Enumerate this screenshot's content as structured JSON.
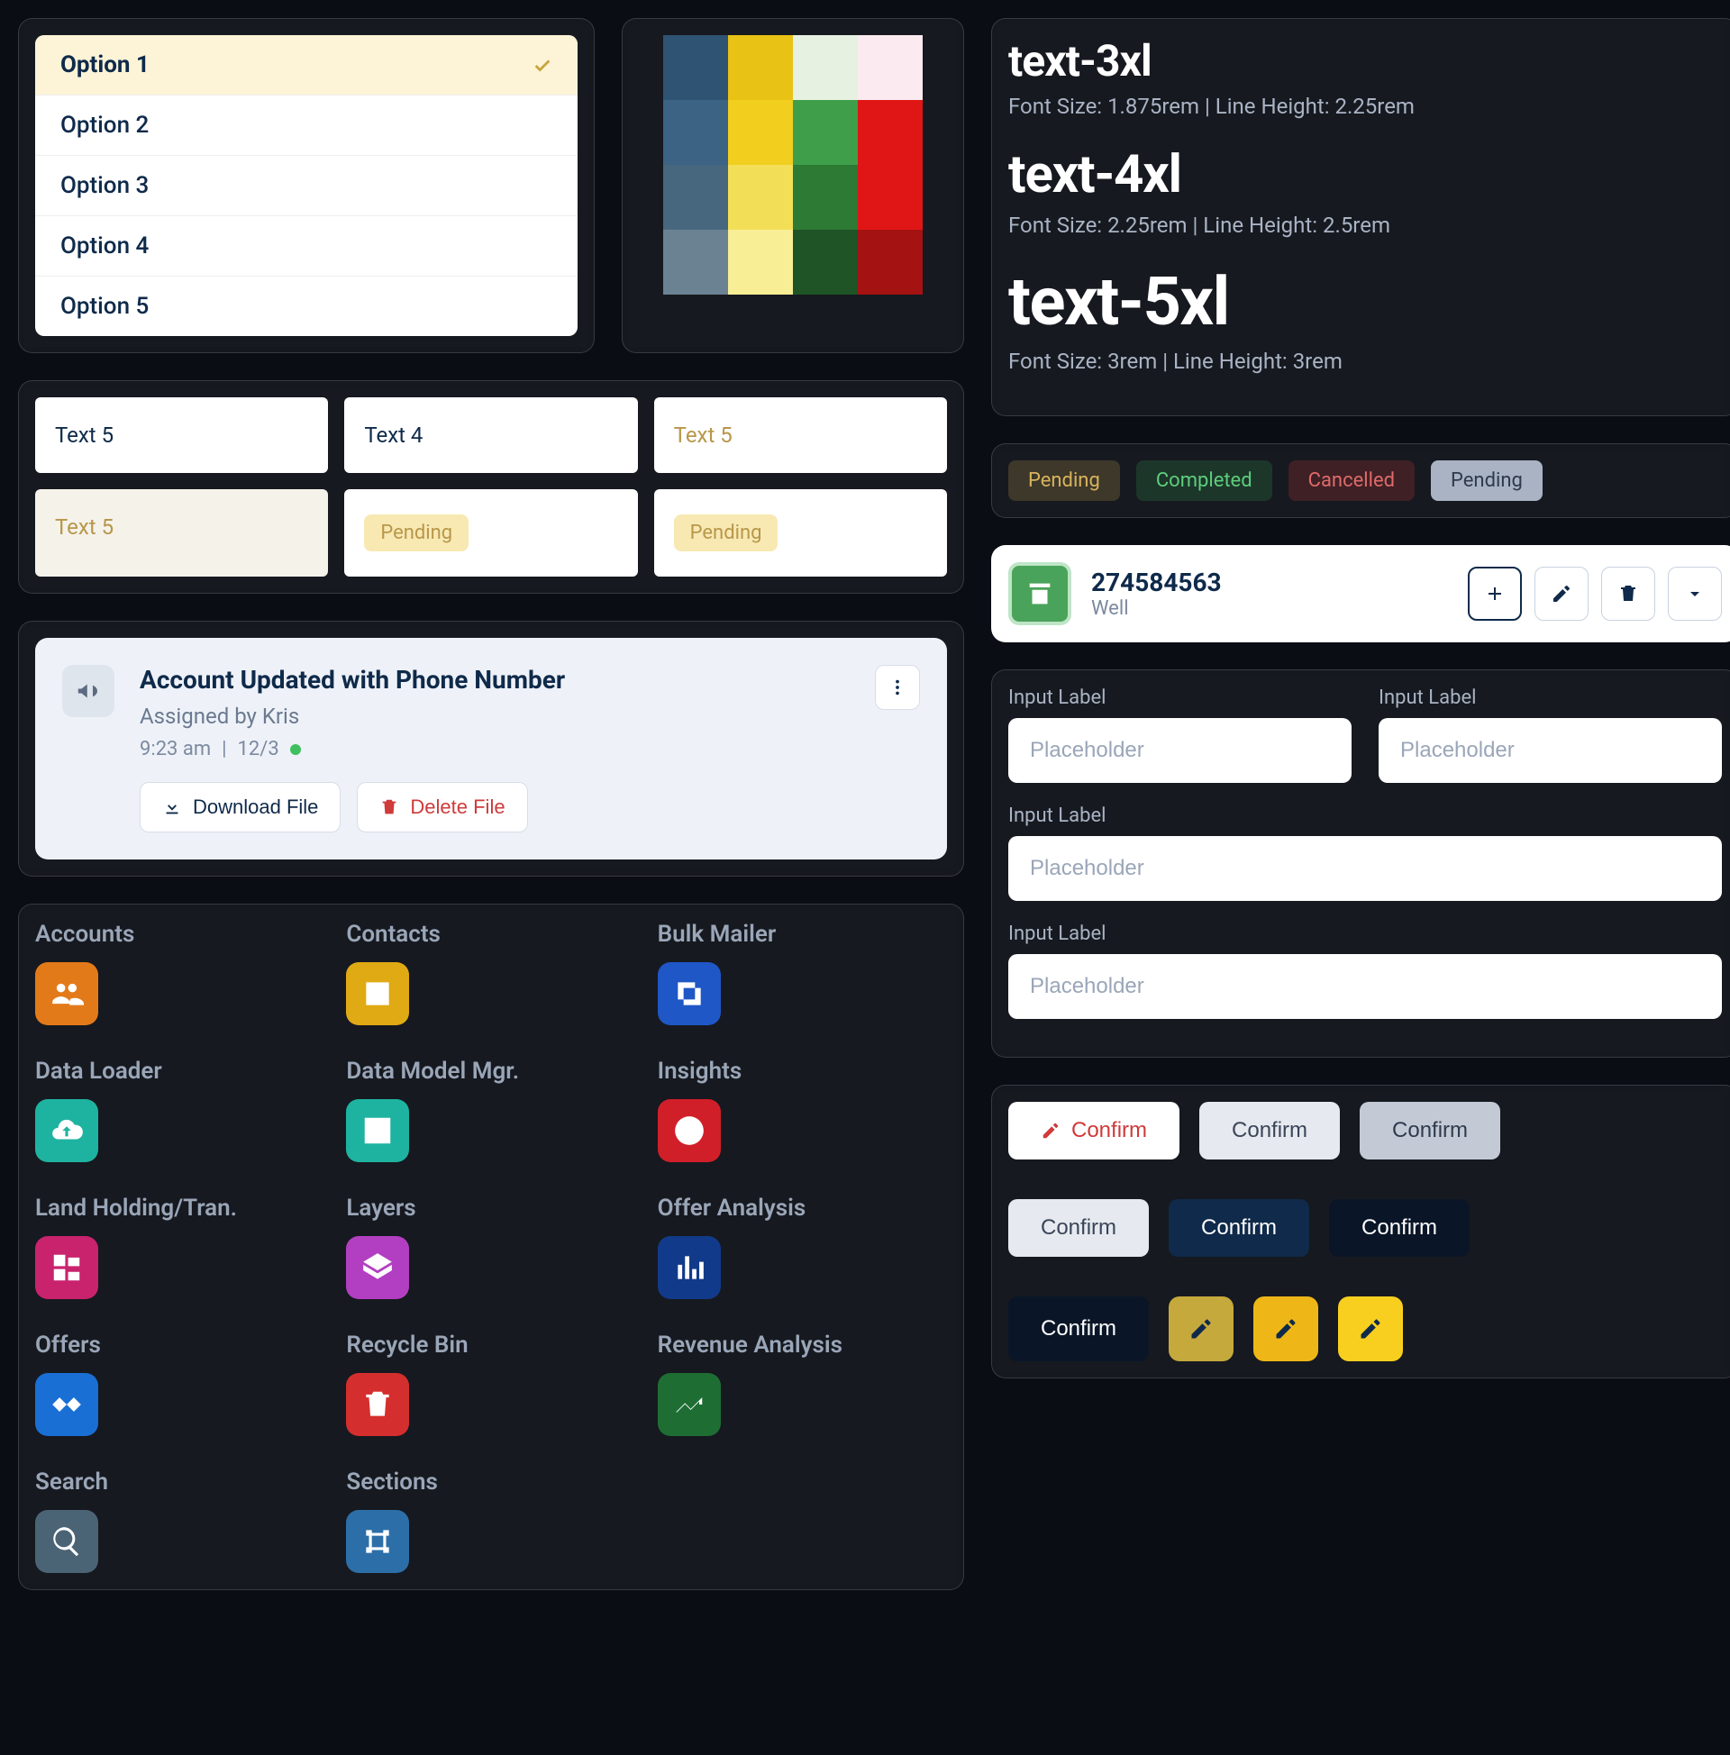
{
  "options": [
    "Option 1",
    "Option 2",
    "Option 3",
    "Option 4",
    "Option 5"
  ],
  "options_selected_index": 0,
  "swatches": [
    "#2f5372",
    "#e9c216",
    "#e6f1e1",
    "#fbeaf0",
    "#3c6383",
    "#f2cf1f",
    "#3f9e4a",
    "#e01616",
    "#47677e",
    "#f3df57",
    "#2d7a34",
    "#e01616",
    "#6b8293",
    "#f7ee96",
    "#1e5426",
    "#a51212"
  ],
  "text_cards": [
    {
      "text": "Text 5",
      "variant": "plain"
    },
    {
      "text": "Text 4",
      "variant": "plain"
    },
    {
      "text": "Text 5",
      "variant": "accent"
    },
    {
      "text": "Text 5",
      "variant": "muted"
    },
    {
      "text": "Pending",
      "variant": "badge"
    },
    {
      "text": "Pending",
      "variant": "badge"
    }
  ],
  "notification": {
    "title": "Account Updated with Phone Number",
    "assigned": "Assigned by Kris",
    "time": "9:23 am",
    "date": "12/3",
    "download_label": "Download File",
    "delete_label": "Delete File"
  },
  "apps": [
    {
      "label": "Accounts",
      "color": "#e37a1a",
      "icon": "people"
    },
    {
      "label": "Contacts",
      "color": "#e0aa14",
      "icon": "id"
    },
    {
      "label": "Bulk Mailer",
      "color": "#1f57c7",
      "icon": "stack"
    },
    {
      "label": "Data Loader",
      "color": "#1eb3a0",
      "icon": "cloud-up"
    },
    {
      "label": "Data Model Mgr.",
      "color": "#1eb3a0",
      "icon": "grid"
    },
    {
      "label": "Insights",
      "color": "#d11f2a",
      "icon": "pie"
    },
    {
      "label": "Land Holding/Tran.",
      "color": "#c9236e",
      "icon": "widgets"
    },
    {
      "label": "Layers",
      "color": "#b23fc2",
      "icon": "layers"
    },
    {
      "label": "Offer Analysis",
      "color": "#123a8a",
      "icon": "bars"
    },
    {
      "label": "Offers",
      "color": "#1a6fd4",
      "icon": "handshake"
    },
    {
      "label": "Recycle Bin",
      "color": "#d52e2e",
      "icon": "trash"
    },
    {
      "label": "Revenue Analysis",
      "color": "#1e6e34",
      "icon": "trend"
    },
    {
      "label": "Search",
      "color": "#4b6475",
      "icon": "search"
    },
    {
      "label": "Sections",
      "color": "#2c6fa8",
      "icon": "bbox"
    }
  ],
  "typography": [
    {
      "name": "text-3xl",
      "detail": "Font Size: 1.875rem | Line Height: 2.25rem",
      "cls": "t3xl"
    },
    {
      "name": "text-4xl",
      "detail": "Font Size: 2.25rem | Line Height: 2.5rem",
      "cls": "t4xl"
    },
    {
      "name": "text-5xl",
      "detail": "Font Size: 3rem | Line Height: 3rem",
      "cls": "t5xl"
    }
  ],
  "status_chips": [
    {
      "text": "Pending",
      "cls": "chip-pending"
    },
    {
      "text": "Completed",
      "cls": "chip-completed"
    },
    {
      "text": "Cancelled",
      "cls": "chip-cancelled"
    },
    {
      "text": "Pending",
      "cls": "chip-grey"
    }
  ],
  "entity": {
    "id": "274584563",
    "type": "Well"
  },
  "inputs": [
    {
      "label": "Input Label",
      "placeholder": "Placeholder",
      "half": true
    },
    {
      "label": "Input Label",
      "placeholder": "Placeholder",
      "half": true
    },
    {
      "label": "Input Label",
      "placeholder": "Placeholder",
      "half": false
    },
    {
      "label": "Input Label",
      "placeholder": "Placeholder",
      "half": false
    }
  ],
  "buttons": {
    "confirm": "Confirm"
  }
}
